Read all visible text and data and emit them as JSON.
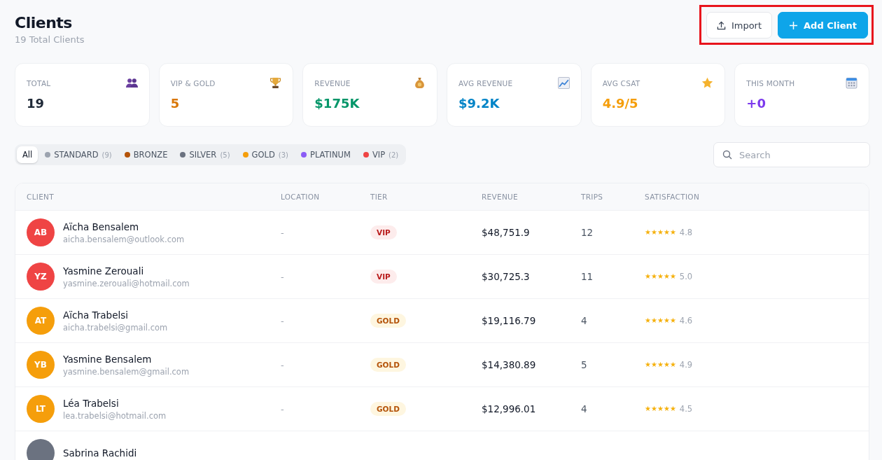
{
  "header": {
    "title": "Clients",
    "subtitle": "19 Total Clients"
  },
  "actions": {
    "highlighted": true,
    "buttons": [
      {
        "kind": "import",
        "label": "Import"
      },
      {
        "kind": "add",
        "label": "Add Client"
      }
    ]
  },
  "stats": [
    {
      "label": "TOTAL",
      "value": "19",
      "kind": "people",
      "color": "#1f2937"
    },
    {
      "label": "VIP & GOLD",
      "value": "5",
      "kind": "trophy",
      "color": "#d97706"
    },
    {
      "label": "REVENUE",
      "value": "$175K",
      "kind": "moneybag",
      "color": "#059669"
    },
    {
      "label": "AVG REVENUE",
      "value": "$9.2K",
      "kind": "chart",
      "color": "#0284c7"
    },
    {
      "label": "AVG CSAT",
      "value": "4.9/5",
      "kind": "star",
      "color": "#f59e0b"
    },
    {
      "label": "THIS MONTH",
      "value": "+0",
      "kind": "calendar",
      "color": "#7c3aed"
    }
  ],
  "filters": [
    {
      "label": "All",
      "selected": true
    },
    {
      "label": "STANDARD",
      "count": "(9)",
      "color": "#9ca3af",
      "selected": false
    },
    {
      "label": "BRONZE",
      "color": "#b45309",
      "selected": false
    },
    {
      "label": "SILVER",
      "count": "(5)",
      "color": "#6b7280",
      "selected": false
    },
    {
      "label": "GOLD",
      "count": "(3)",
      "color": "#f59e0b",
      "selected": false
    },
    {
      "label": "PLATINUM",
      "color": "#8b5cf6",
      "selected": false
    },
    {
      "label": "VIP",
      "count": "(2)",
      "color": "#ef4444",
      "selected": false
    }
  ],
  "search": {
    "placeholder": "Search"
  },
  "table": {
    "columns": [
      "CLIENT",
      "LOCATION",
      "TIER",
      "REVENUE",
      "TRIPS",
      "SATISFACTION"
    ],
    "rows": [
      {
        "initials": "AB",
        "color": "#ef4444",
        "name": "Aïcha Bensalem",
        "email": "aicha.bensalem@outlook.com",
        "location": "-",
        "tier": "VIP",
        "kind": "vip",
        "revenue": "$48,751.9",
        "trips": "12",
        "stars": 5,
        "rating": "4.8"
      },
      {
        "initials": "YZ",
        "color": "#ef4444",
        "name": "Yasmine Zerouali",
        "email": "yasmine.zerouali@hotmail.com",
        "location": "-",
        "tier": "VIP",
        "kind": "vip",
        "revenue": "$30,725.3",
        "trips": "11",
        "stars": 5,
        "rating": "5.0"
      },
      {
        "initials": "AT",
        "color": "#f59e0b",
        "name": "Aïcha Trabelsi",
        "email": "aicha.trabelsi@gmail.com",
        "location": "-",
        "tier": "GOLD",
        "kind": "gold",
        "revenue": "$19,116.79",
        "trips": "4",
        "stars": 5,
        "rating": "4.6"
      },
      {
        "initials": "YB",
        "color": "#f59e0b",
        "name": "Yasmine Bensalem",
        "email": "yasmine.bensalem@gmail.com",
        "location": "-",
        "tier": "GOLD",
        "kind": "gold",
        "revenue": "$14,380.89",
        "trips": "5",
        "stars": 5,
        "rating": "4.9"
      },
      {
        "initials": "LT",
        "color": "#f59e0b",
        "name": "Léa Trabelsi",
        "email": "lea.trabelsi@hotmail.com",
        "location": "-",
        "tier": "GOLD",
        "kind": "gold",
        "revenue": "$12,996.01",
        "trips": "4",
        "stars": 5,
        "rating": "4.5"
      },
      {
        "color": "#6b7280",
        "name": "Sabrina Rachidi"
      }
    ]
  }
}
